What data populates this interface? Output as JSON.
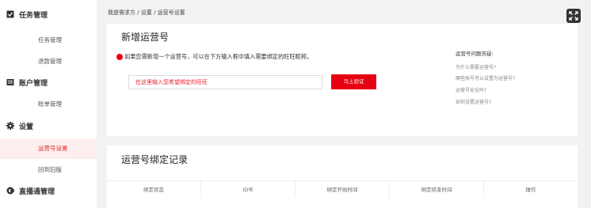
{
  "sidebar": {
    "groups": [
      {
        "label": "任务管理",
        "icon": "task-icon",
        "items": [
          "任务管理",
          "退款管理"
        ]
      },
      {
        "label": "账户管理",
        "icon": "account-icon",
        "items": [
          "账单管理"
        ]
      },
      {
        "label": "设置",
        "icon": "gear-icon",
        "items": [
          "运营号设置",
          "回到旧版"
        ]
      },
      {
        "label": "直播通管理",
        "icon": "live-icon",
        "items": []
      }
    ],
    "active_item": "运营号设置"
  },
  "breadcrumb": {
    "text": "我是需求方 / 设置 / 运营号设置"
  },
  "add_section": {
    "title": "新增运营号",
    "hint": "如果您需新增一个运营号，可以在下方输入框中填入需要绑定的旺旺昵称。",
    "input_value": "在这里输入您希望绑定的旺旺",
    "verify_button": "马上验证"
  },
  "faq": {
    "title": "运营号问题答疑:",
    "links": [
      "为什么需要运营号?",
      "哪些账号可以设置为运营号?",
      "运营号安全吗?",
      "如何设置运营号?"
    ]
  },
  "records": {
    "title": "运营号绑定记录",
    "columns": [
      "绑定状态",
      "ID号",
      "绑定开始时间",
      "绑定结束时间",
      "操作"
    ]
  },
  "colors": {
    "accent": "#e60012",
    "active_bg": "#fdeeee"
  }
}
